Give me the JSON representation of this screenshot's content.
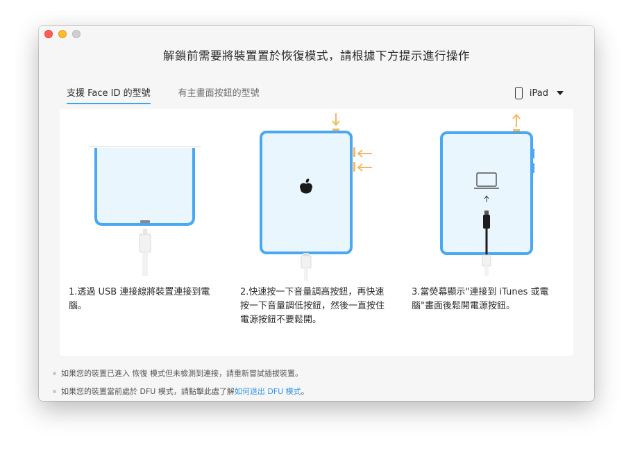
{
  "window": {
    "title": "解鎖前需要將裝置置於恢復模式，請根據下方提示進行操作"
  },
  "tabs": [
    {
      "label": "支援 Face ID 的型號",
      "active": true
    },
    {
      "label": "有主畫面按鈕的型號",
      "active": false
    }
  ],
  "device_select": {
    "value": "iPad",
    "icon": "tablet-icon"
  },
  "steps": [
    {
      "text": "1.透過 USB 連接線將裝置連接到電腦。"
    },
    {
      "text": "2.快速按一下音量調高按鈕，再快速按一下音量調低按鈕，然後一直按住電源按鈕不要鬆開。"
    },
    {
      "text": "3.當熒幕顯示\"連接到 iTunes 或電腦\"畫面後鬆開電源按鈕。"
    }
  ],
  "notes": [
    {
      "text": "如果您的裝置已進入 恢復 模式但未檢測到連接，請重新嘗試插拔裝置。"
    },
    {
      "text": "如果您的裝置當前處於 DFU 模式，請點擊此處了解",
      "link": "如何退出 DFU 模式",
      "suffix": "。"
    }
  ],
  "colors": {
    "accent": "#3aa6f0",
    "device_frame": "#4aa8f2",
    "screen_fill": "#eaf6fe",
    "arrow": "#f7b761",
    "link": "#2f94e6"
  }
}
